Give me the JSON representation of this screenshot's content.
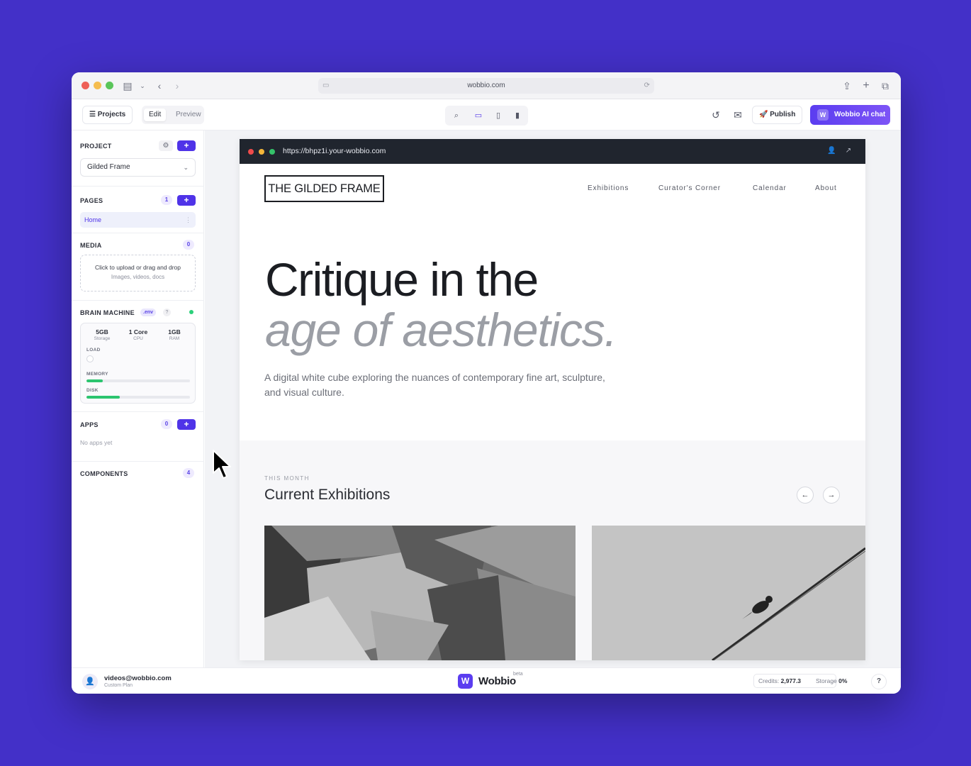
{
  "browser": {
    "url": "wobbio.com"
  },
  "toolbar": {
    "projects_label": "Projects",
    "edit_label": "Edit",
    "preview_label": "Preview",
    "publish_label": "Publish",
    "ai_chat_label": "Wobbio AI chat",
    "ai_logo": "W"
  },
  "sidebar": {
    "project": {
      "title": "PROJECT",
      "selected": "Gilded Frame"
    },
    "pages": {
      "title": "PAGES",
      "count": "1",
      "items": [
        {
          "label": "Home"
        }
      ]
    },
    "media": {
      "title": "MEDIA",
      "count": "0",
      "upload_text": "Click to upload or drag and drop",
      "upload_sub": "Images, videos, docs"
    },
    "brain": {
      "title": "BRAIN MACHINE",
      "env_tag": ".env",
      "help": "?",
      "status_color": "#2bd07a",
      "stats": [
        {
          "value": "5GB",
          "label": "Storage"
        },
        {
          "value": "1 Core",
          "label": "CPU"
        },
        {
          "value": "1GB",
          "label": "RAM"
        }
      ],
      "load_label": "LOAD",
      "memory_label": "MEMORY",
      "memory_fraction": 0.16,
      "disk_label": "DISK",
      "disk_fraction": 0.32
    },
    "apps": {
      "title": "APPS",
      "count": "0",
      "empty_text": "No apps yet"
    },
    "components": {
      "title": "COMPONENTS",
      "count": "4"
    }
  },
  "site": {
    "url": "https://bhpz1i.your-wobbio.com",
    "brand": "THE GILDED FRAME",
    "nav": [
      "Exhibitions",
      "Curator's Corner",
      "Calendar",
      "About"
    ],
    "hero_line1": "Critique in the",
    "hero_line2": "age of aesthetics.",
    "hero_sub": "A digital white cube exploring the nuances of contemporary fine art, sculpture, and visual culture.",
    "section_kicker": "THIS MONTH",
    "section_title": "Current Exhibitions"
  },
  "footer": {
    "email": "videos@wobbio.com",
    "plan": "Custom Plan",
    "brand": "Wobbio",
    "brand_logo": "W",
    "beta": "beta",
    "credits_label": "Credits:",
    "credits_value": "2,977.3",
    "storage_label": "Storage",
    "storage_value": "0%",
    "help": "?"
  },
  "colors": {
    "background": "#4330c8",
    "accent": "#4f33e8",
    "site_bar": "#20252e"
  }
}
